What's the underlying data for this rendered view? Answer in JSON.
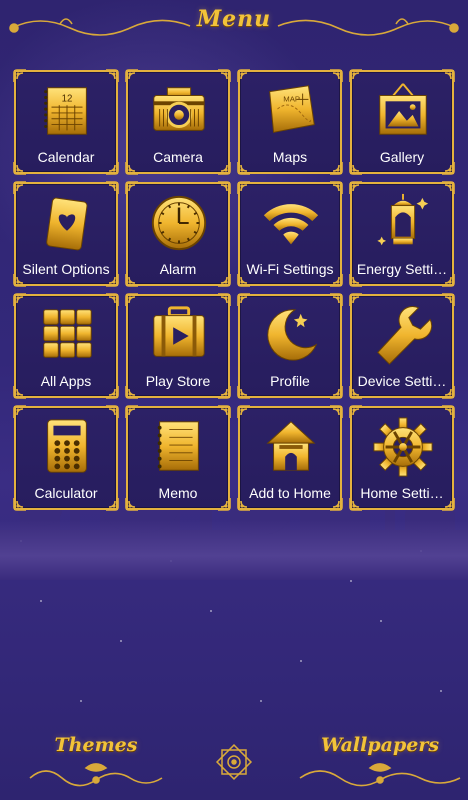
{
  "header": {
    "title": "Menu"
  },
  "apps": [
    {
      "label": "Calendar",
      "icon": "calendar-icon"
    },
    {
      "label": "Camera",
      "icon": "camera-icon"
    },
    {
      "label": "Maps",
      "icon": "map-icon"
    },
    {
      "label": "Gallery",
      "icon": "picture-frame-icon"
    },
    {
      "label": "Silent Options",
      "icon": "heart-card-icon"
    },
    {
      "label": "Alarm",
      "icon": "clock-icon"
    },
    {
      "label": "Wi-Fi Settings",
      "icon": "wifi-icon"
    },
    {
      "label": "Energy Setti…",
      "icon": "lantern-icon"
    },
    {
      "label": "All Apps",
      "icon": "app-grid-icon"
    },
    {
      "label": "Play Store",
      "icon": "play-store-icon"
    },
    {
      "label": "Profile",
      "icon": "crescent-star-icon"
    },
    {
      "label": "Device Setti…",
      "icon": "wrench-icon"
    },
    {
      "label": "Calculator",
      "icon": "calculator-icon"
    },
    {
      "label": "Memo",
      "icon": "notepad-icon"
    },
    {
      "label": "Add to Home",
      "icon": "house-icon"
    },
    {
      "label": "Home Setti…",
      "icon": "gear-icon"
    }
  ],
  "calendar_icon_number": "12",
  "map_icon_text": "MAP",
  "bottom": {
    "themes_label": "Themes",
    "wallpapers_label": "Wallpapers"
  },
  "colors": {
    "gold": "#e4b23e",
    "background": "#2f2470",
    "label": "#ffffff"
  }
}
